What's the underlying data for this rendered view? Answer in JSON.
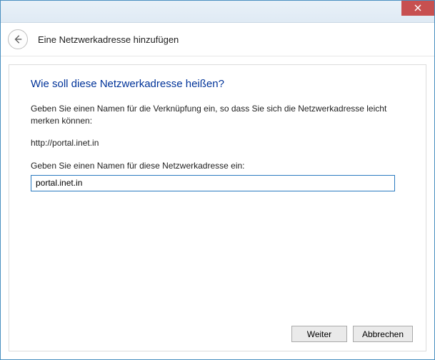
{
  "window": {
    "header_title": "Eine Netzwerkadresse hinzufügen"
  },
  "main": {
    "heading": "Wie soll diese Netzwerkadresse heißen?",
    "instruction": "Geben Sie einen Namen für die Verknüpfung ein, so dass Sie sich die Netzwerkadresse leicht merken können:",
    "url": "http://portal.inet.in",
    "input_label": "Geben Sie einen Namen für diese Netzwerkadresse ein:",
    "input_value": "portal.inet.in"
  },
  "buttons": {
    "next": "Weiter",
    "cancel": "Abbrechen"
  }
}
